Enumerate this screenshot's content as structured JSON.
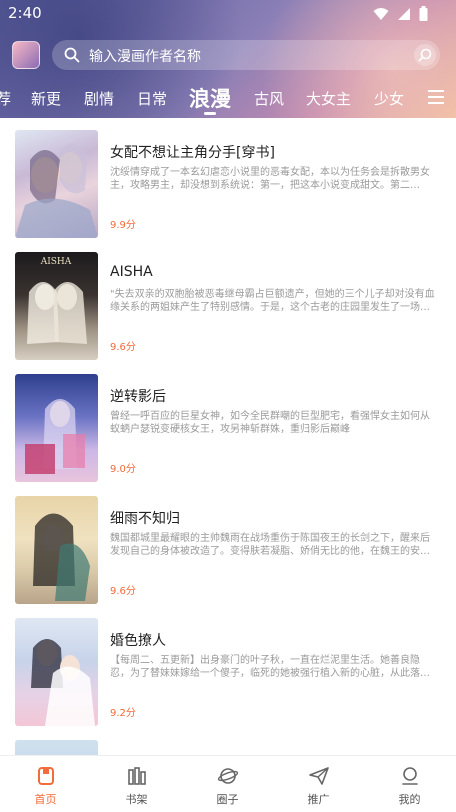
{
  "status_bar": {
    "time": "2:40",
    "icons": [
      "wifi-icon",
      "signal-icon",
      "battery-icon"
    ]
  },
  "search": {
    "placeholder": "输入漫画作者名称"
  },
  "tabs": [
    {
      "label": "荐"
    },
    {
      "label": "新更"
    },
    {
      "label": "剧情"
    },
    {
      "label": "日常"
    },
    {
      "label": "浪漫",
      "active": true
    },
    {
      "label": "古风"
    },
    {
      "label": "大女主"
    },
    {
      "label": "少女"
    }
  ],
  "comics": [
    {
      "title": "女配不想让主角分手[穿书]",
      "desc": "沈绥情穿成了一本玄幻虐恋小说里的恶毒女配，本以为任务会是拆散男女主，攻略男主，却没想到系统说：第一，把这本小说变成甜文。第二…",
      "score": "9.9分"
    },
    {
      "title": "AISHA",
      "desc": "\"失去双亲的双胞胎被恶毒继母霸占巨额遗产，但她的三个儿子却对没有血缘关系的两姐妹产生了特别感情。于是，这个古老的庄园里发生了一场…",
      "score": "9.6分"
    },
    {
      "title": "逆转影后",
      "desc": "曾经一呼百应的巨星女神，如今全民群嘲的巨型肥宅，看强悍女主如何从蚁蛃户瑟锐变硬核女王，攻另神斩群姝，重归影后巅峰",
      "score": "9.0分"
    },
    {
      "title": "细雨不知归",
      "desc": "魏国都城里最耀眼的主帅魏雨在战场重伤于陈国夜王的长剑之下，醒来后发现自己的身体被改造了。变得肤若凝脂、娇俏无比的他，在魏王的安…",
      "score": "9.6分"
    },
    {
      "title": "婚色撩人",
      "desc": "【每周二、五更新】出身豪门的叶子秋，一直在烂泥里生活。她善良隐忍，为了替妹妹嫁给一个傻子，临死的她被强行植入新的心脏，从此落…",
      "score": "9.2分"
    }
  ],
  "bottom_nav": [
    {
      "label": "首页",
      "icon": "home-icon",
      "active": true
    },
    {
      "label": "书架",
      "icon": "bookshelf-icon"
    },
    {
      "label": "圈子",
      "icon": "planet-icon"
    },
    {
      "label": "推广",
      "icon": "paper-plane-icon"
    },
    {
      "label": "我的",
      "icon": "profile-icon"
    }
  ],
  "colors": {
    "accent": "#f26b3a",
    "score": "#f06a3a"
  }
}
